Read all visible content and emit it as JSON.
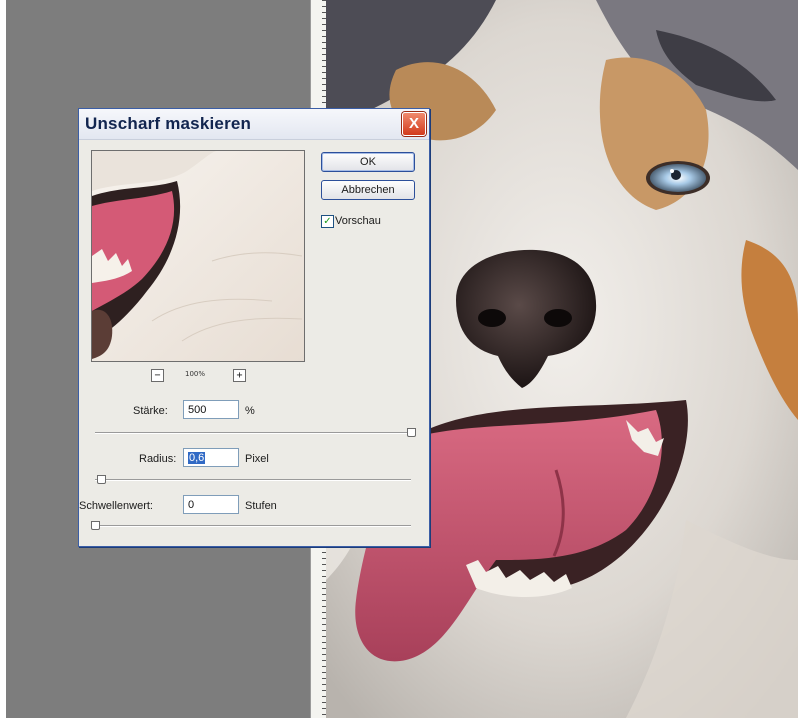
{
  "dialog": {
    "title": "Unscharf maskieren",
    "close_label": "X",
    "ok_label": "OK",
    "cancel_label": "Abbrechen",
    "preview_label": "Vorschau",
    "preview_checked": true,
    "zoom_out_label": "−",
    "zoom_in_label": "+",
    "zoom_level": "100%",
    "fields": {
      "staerke": {
        "label": "Stärke:",
        "value": "500",
        "unit": "%",
        "slider_fraction": 1.0
      },
      "radius": {
        "label": "Radius:",
        "value": "0,6",
        "unit": "Pixel",
        "slider_fraction": 0.02
      },
      "schwellenwert": {
        "label": "Schwellenwert:",
        "value": "0",
        "unit": "Stufen",
        "slider_fraction": 0.0
      }
    }
  },
  "colors": {
    "workspace_gray": "#7d7d7d",
    "dialog_bg": "#ecebe6",
    "close_red": "#d23a1c",
    "selection_blue": "#316ac5"
  }
}
